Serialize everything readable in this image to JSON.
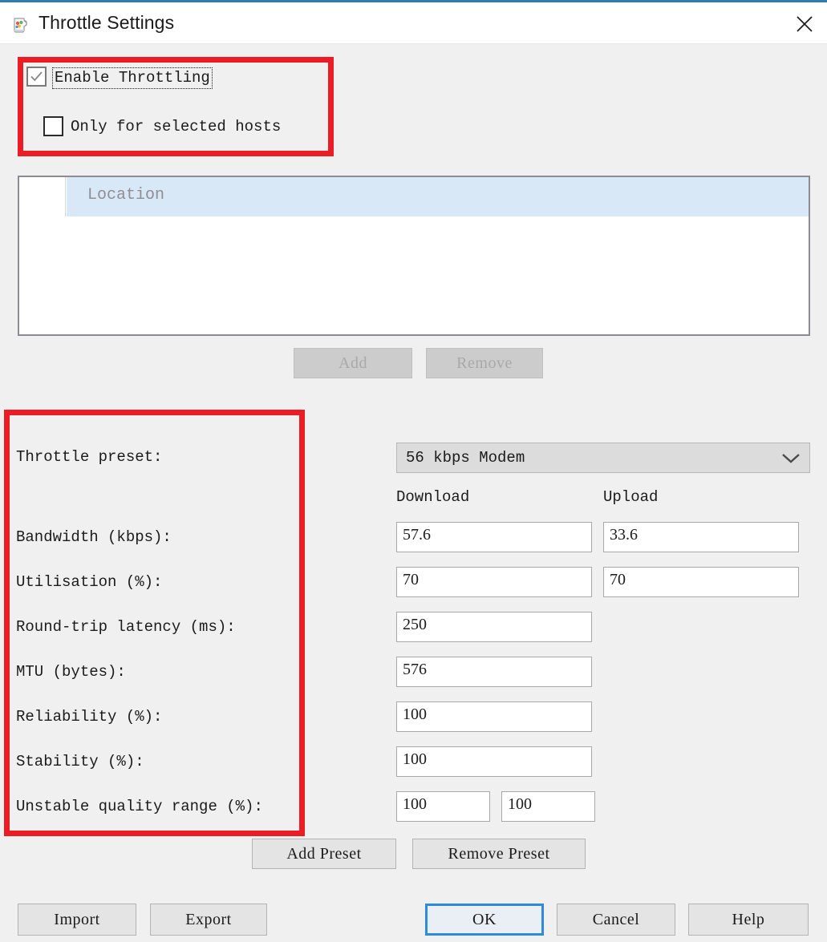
{
  "window": {
    "title": "Throttle Settings",
    "app_icon": "jug-icon",
    "close_icon": "close-icon",
    "accent_color": "#2e7cb0"
  },
  "options": {
    "enable_throttling": {
      "label": "Enable Throttling",
      "checked": true,
      "focused": true
    },
    "only_selected_hosts": {
      "label": "Only for selected hosts",
      "checked": false
    }
  },
  "host_list": {
    "columns": [
      "",
      "Location"
    ],
    "rows": []
  },
  "list_buttons": {
    "add": {
      "label": "Add",
      "disabled": true
    },
    "remove": {
      "label": "Remove",
      "disabled": true
    }
  },
  "settings": {
    "labels": [
      "Throttle preset:",
      "Bandwidth (kbps):",
      "Utilisation (%):",
      "Round-trip latency (ms):",
      "MTU (bytes):",
      "Reliability (%):",
      "Stability (%):",
      "Unstable quality range (%):"
    ],
    "preset": {
      "selected": "56 kbps Modem",
      "chevron_icon": "chevron-down-icon"
    },
    "column_headers": {
      "download": "Download",
      "upload": "Upload"
    },
    "values": {
      "bandwidth": {
        "download": "57.6",
        "upload": "33.6"
      },
      "utilisation": {
        "download": "70",
        "upload": "70"
      },
      "latency": {
        "download": "250"
      },
      "mtu": {
        "download": "576"
      },
      "reliability": {
        "download": "100"
      },
      "stability": {
        "download": "100"
      },
      "unstable_quality_range": {
        "min": "100",
        "max": "100"
      }
    }
  },
  "preset_buttons": {
    "add_preset": "Add Preset",
    "remove_preset": "Remove Preset"
  },
  "footer_buttons": {
    "import": "Import",
    "export": "Export",
    "ok": "OK",
    "cancel": "Cancel",
    "help": "Help"
  },
  "annotations": {
    "highlight_color": "#ec1c24",
    "boxes": [
      "enable-throttling-group",
      "settings-labels-column"
    ]
  }
}
